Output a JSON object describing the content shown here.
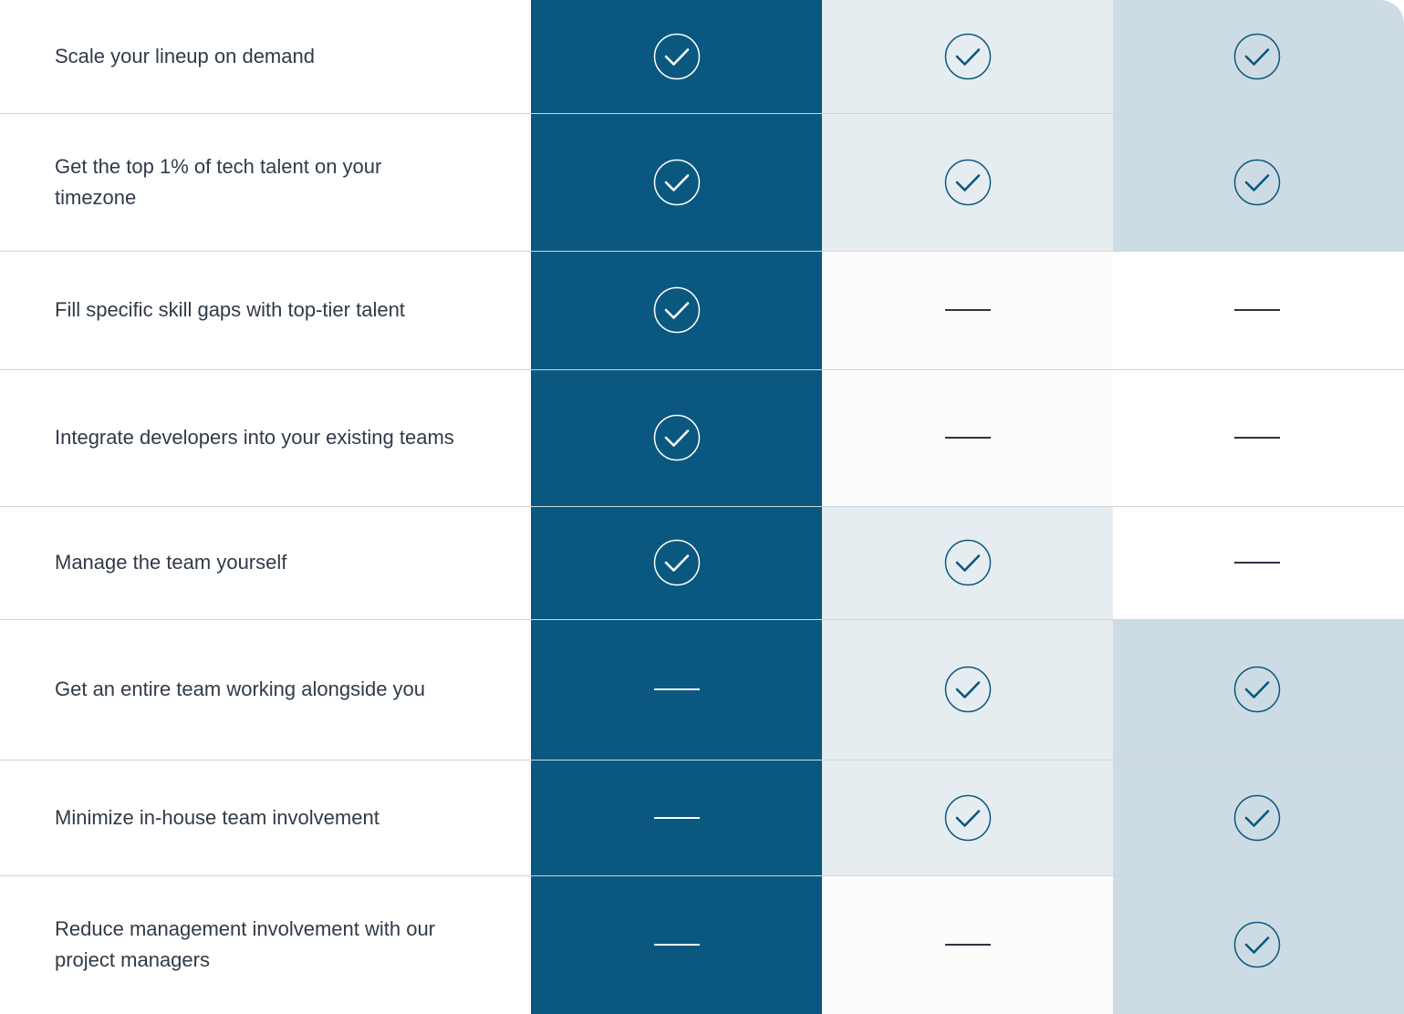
{
  "colors": {
    "accent": "#0a5880",
    "light_band": "#e6edf1",
    "mid_band": "#cddce4",
    "empty_band": "#fcfcfc",
    "divider": "#cfd6db",
    "text": "#2f3b47"
  },
  "icons": {
    "included": "check-circle-icon",
    "not_included": "dash-icon"
  },
  "rows": [
    {
      "feature": "Scale your lineup on demand",
      "values": [
        true,
        true,
        true
      ]
    },
    {
      "feature": "Get the top 1% of tech talent on your timezone",
      "values": [
        true,
        true,
        true
      ]
    },
    {
      "feature": "Fill specific skill gaps with top-tier talent",
      "values": [
        true,
        false,
        false
      ]
    },
    {
      "feature": "Integrate developers into your existing teams",
      "values": [
        true,
        false,
        false
      ]
    },
    {
      "feature": "Manage the team yourself",
      "values": [
        true,
        true,
        false
      ]
    },
    {
      "feature": "Get an entire team working alongside you",
      "values": [
        false,
        true,
        true
      ]
    },
    {
      "feature": "Minimize in-house team involvement",
      "values": [
        false,
        true,
        true
      ]
    },
    {
      "feature": "Reduce management involvement with our project managers",
      "values": [
        false,
        false,
        true
      ]
    }
  ]
}
